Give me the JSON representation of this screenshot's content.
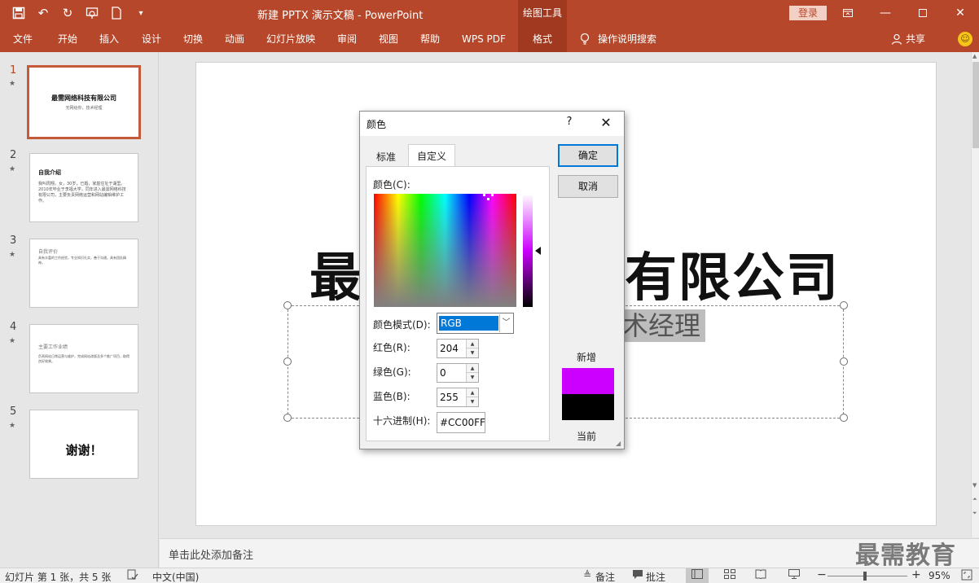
{
  "titlebar": {
    "title": "新建 PPTX 演示文稿 - PowerPoint",
    "context_tab": "绘图工具",
    "login": "登录"
  },
  "ribbon": {
    "tabs": [
      "文件",
      "开始",
      "插入",
      "设计",
      "切换",
      "动画",
      "幻灯片放映",
      "审阅",
      "视图",
      "帮助",
      "WPS PDF",
      "格式"
    ],
    "active_tab": "格式",
    "tell_me": "操作说明搜索",
    "share": "共享"
  },
  "thumbnails": [
    {
      "num": "1",
      "title": "最需网络科技有限公司",
      "subtitle": "无网给你，技术经理"
    },
    {
      "num": "2",
      "title": "自我介绍",
      "body": "我叫周翔，女，30岁，已婚，家庭住址于湖里。2010年毕业于李福大学，同年进入最需网络科技有限公司，主要负责网络运营和网站编辑维护工作。"
    },
    {
      "num": "3",
      "title": "自我评价",
      "body": "具有丰富的工作经验，专业知识扎实，善于沟通，具有团队精神。"
    },
    {
      "num": "4",
      "title": "主要工作业绩",
      "body": "负责网站日常运营与维护，完成网站改版及多个推广项目，取得良好效果。"
    },
    {
      "num": "5",
      "title": "谢谢！"
    }
  ],
  "slide": {
    "title_left": "最",
    "title_right": "有限公司",
    "subtitle_visible": "术经理"
  },
  "notes": {
    "placeholder": "单击此处添加备注"
  },
  "watermark": "最需教育",
  "statusbar": {
    "slide_info": "幻灯片 第 1 张，共 5 张",
    "language": "中文(中国)",
    "notes_label": "备注",
    "comments_label": "批注",
    "zoom_minus": "−",
    "zoom_plus": "+",
    "zoom_level": "95%"
  },
  "dialog": {
    "title": "颜色",
    "help": "?",
    "tabs": [
      "标准",
      "自定义"
    ],
    "active_tab": "自定义",
    "colors_label": "颜色(C):",
    "color_mode_label": "颜色模式(D):",
    "color_mode_value": "RGB",
    "red_label": "红色(R):",
    "red_value": "204",
    "green_label": "绿色(G):",
    "green_value": "0",
    "blue_label": "蓝色(B):",
    "blue_value": "255",
    "hex_label": "十六进制(H):",
    "hex_value": "#CC00FF",
    "ok_label": "确定",
    "cancel_label": "取消",
    "new_label": "新增",
    "current_label": "当前",
    "new_color": "#cc00ff",
    "current_color": "#000000"
  }
}
